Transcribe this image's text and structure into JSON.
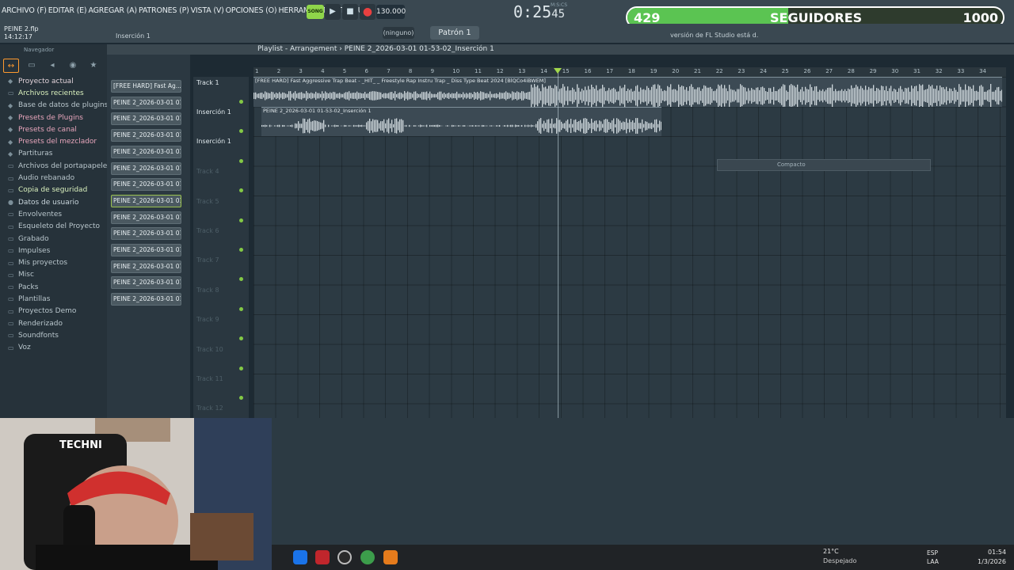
{
  "menu": {
    "items": [
      "ARCHIVO (F)",
      "EDITAR (E)",
      "AGREGAR (A)",
      "PATRONES (P)",
      "VISTA (V)",
      "OPCIONES (O)",
      "HERRAMIENTAS (T)",
      "AYUDA"
    ]
  },
  "transport": {
    "song_label": "SONG",
    "play_icon": "▶",
    "stop_icon": "■",
    "record_icon": "●",
    "tempo": "130.000",
    "time": "0:25",
    "time_sub": "45",
    "time_unit": "M:S:CS"
  },
  "followers": {
    "count": "429",
    "label": "SEGUIDORES",
    "goal": "1000",
    "progress": 0.429
  },
  "project": {
    "name": "PEINE 2.flp",
    "time": "14:12:17",
    "insert": "Inserción 1"
  },
  "toolbar": {
    "snap": "(ninguno)",
    "pattern": "Patrón 1",
    "news": "versión de FL Studio está d."
  },
  "browser": {
    "title": "Navegador",
    "items": [
      {
        "label": "Proyecto actual",
        "icon": "project-icon",
        "color": "#e1d2d9"
      },
      {
        "label": "Archivos recientes",
        "icon": "folder-icon",
        "color": "#d9f0bd"
      },
      {
        "label": "Base de datos de plugins",
        "icon": "plugin-icon",
        "color": "#b9c6cc"
      },
      {
        "label": "Presets de Plugins",
        "icon": "preset-icon",
        "color": "#e7a5bb"
      },
      {
        "label": "Presets de canal",
        "icon": "preset-icon",
        "color": "#e7a5bb"
      },
      {
        "label": "Presets del mezclador",
        "icon": "preset-icon",
        "color": "#e7a5bb"
      },
      {
        "label": "Partituras",
        "icon": "score-icon",
        "color": "#b9c6cc"
      },
      {
        "label": "Archivos del portapapeles",
        "icon": "folder-icon",
        "color": "#b9c6cc"
      },
      {
        "label": "Audio rebanado",
        "icon": "folder-icon",
        "color": "#b9c6cc"
      },
      {
        "label": "Copia de seguridad",
        "icon": "folder-icon",
        "color": "#d9f0bd"
      },
      {
        "label": "Datos de usuario",
        "icon": "user-icon",
        "color": "#c9d6dc"
      },
      {
        "label": "Envolventes",
        "icon": "folder-icon",
        "color": "#b9c6cc"
      },
      {
        "label": "Esqueleto del Proyecto",
        "icon": "folder-icon",
        "color": "#b9c6cc"
      },
      {
        "label": "Grabado",
        "icon": "folder-icon",
        "color": "#b9c6cc"
      },
      {
        "label": "Impulses",
        "icon": "folder-icon",
        "color": "#b9c6cc"
      },
      {
        "label": "Mis proyectos",
        "icon": "folder-icon",
        "color": "#b9c6cc"
      },
      {
        "label": "Misc",
        "icon": "folder-icon",
        "color": "#b9c6cc"
      },
      {
        "label": "Packs",
        "icon": "folder-icon",
        "color": "#b9c6cc"
      },
      {
        "label": "Plantillas",
        "icon": "folder-icon",
        "color": "#b9c6cc"
      },
      {
        "label": "Proyectos Demo",
        "icon": "folder-icon",
        "color": "#b9c6cc"
      },
      {
        "label": "Renderizado",
        "icon": "folder-icon",
        "color": "#b9c6cc"
      },
      {
        "label": "Soundfonts",
        "icon": "folder-icon",
        "color": "#b9c6cc"
      },
      {
        "label": "Voz",
        "icon": "folder-icon",
        "color": "#b9c6cc"
      }
    ]
  },
  "picker": {
    "clips": [
      "[FREE HARD] Fast Ag...",
      "PEINE 2_2026-03-01 01-...",
      "PEINE 2_2026-03-01 01-...",
      "PEINE 2_2026-03-01 01-...",
      "PEINE 2_2026-03-01 01-...",
      "PEINE 2_2026-03-01 01-...",
      "PEINE 2_2026-03-01 01-...",
      "PEINE 2_2026-03-01 01-...",
      "PEINE 2_2026-03-01 01-...",
      "PEINE 2_2026-03-01 01-...",
      "PEINE 2_2026-03-01 01-...",
      "PEINE 2_2026-03-01 01-...",
      "PEINE 2_2026-03-01 01-...",
      "PEINE 2_2026-03-01 01-..."
    ]
  },
  "playlist": {
    "title": "Playlist - Arrangement",
    "breadcrumb": "PEINE 2_2026-03-01 01-53-02_Inserción 1",
    "tracks": [
      "Track 1",
      "Inserción 1",
      "Inserción 1",
      "Track 4",
      "Track 5",
      "Track 6",
      "Track 7",
      "Track 8",
      "Track 9",
      "Track 10",
      "Track 11",
      "Track 12"
    ],
    "ruler": [
      "1",
      "2",
      "3",
      "4",
      "5",
      "6",
      "7",
      "8",
      "9",
      "10",
      "11",
      "12",
      "13",
      "14",
      "15",
      "16",
      "17",
      "18",
      "19",
      "20",
      "21",
      "22",
      "23",
      "24",
      "25",
      "26",
      "27",
      "28",
      "29",
      "30",
      "31",
      "32",
      "33",
      "34"
    ],
    "clip1": "[FREE HARD] Fast Aggressive Trap Beat - _HIT_ _ Freestyle Rap Instru Trap _ Diss Type Beat 2024 [BlQCo4iBWEM]",
    "clip2": "PEINE 2_2026-03-01 01-53-02_Inserción 1",
    "compact": "Compacto"
  },
  "taskbar": {
    "temp": "21°C",
    "weather": "Despejado",
    "lang1": "ESP",
    "lang2": "LAA",
    "time": "01:54",
    "date": "1/3/2026"
  }
}
